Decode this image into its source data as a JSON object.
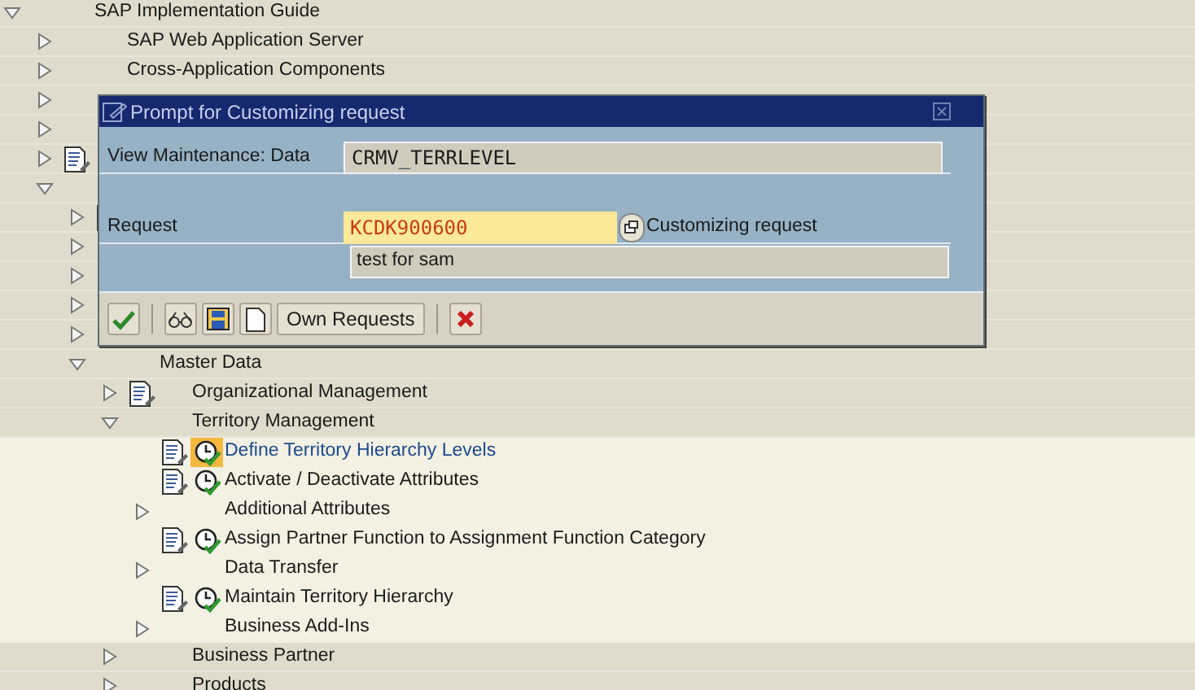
{
  "tree": [
    {
      "label": "SAP Implementation Guide",
      "kind": "folder",
      "expanded": true,
      "doc_icon": false,
      "selected": false,
      "children": [
        {
          "label": "SAP Web Application Server",
          "kind": "folder",
          "expanded": false,
          "doc_icon": false,
          "selected": false
        },
        {
          "label": "Cross-Application Components",
          "kind": "folder",
          "expanded": false,
          "doc_icon": false,
          "selected": false
        },
        {
          "kind": "folder",
          "expanded": false,
          "doc_icon": false,
          "selected": false
        },
        {
          "kind": "folder",
          "expanded": false,
          "doc_icon": false,
          "selected": false
        },
        {
          "kind": "folder",
          "expanded": false,
          "doc_icon": true,
          "selected": false
        },
        {
          "kind": "folder",
          "expanded": true,
          "doc_icon": false,
          "selected": false,
          "children": [
            {
              "kind": "folder",
              "expanded": false,
              "doc_icon": true,
              "selected": false
            },
            {
              "kind": "folder",
              "expanded": false,
              "doc_icon": false,
              "selected": false
            },
            {
              "kind": "folder",
              "expanded": false,
              "doc_icon": false,
              "selected": false
            },
            {
              "kind": "folder",
              "expanded": false,
              "doc_icon": false,
              "selected": false
            },
            {
              "kind": "folder",
              "expanded": false,
              "doc_icon": false,
              "selected": false
            },
            {
              "label": "Master Data",
              "kind": "folder",
              "expanded": true,
              "doc_icon": false,
              "selected": false,
              "children": [
                {
                  "label": "Organizational Management",
                  "kind": "folder",
                  "expanded": false,
                  "doc_icon": true,
                  "selected": false
                },
                {
                  "label": "Territory Management",
                  "kind": "folder",
                  "expanded": true,
                  "doc_icon": false,
                  "selected": false,
                  "children": [
                    {
                      "label": "Define Territory Hierarchy Levels",
                      "kind": "activity",
                      "doc_icon": true,
                      "selected": true
                    },
                    {
                      "label": "Activate / Deactivate Attributes",
                      "kind": "activity",
                      "doc_icon": true,
                      "selected": false
                    },
                    {
                      "label": "Additional Attributes",
                      "kind": "folder",
                      "expanded": false,
                      "doc_icon": false,
                      "selected": false
                    },
                    {
                      "label": "Assign Partner Function to Assignment Function Category",
                      "kind": "activity",
                      "doc_icon": true,
                      "selected": false
                    },
                    {
                      "label": "Data Transfer",
                      "kind": "folder",
                      "expanded": false,
                      "doc_icon": false,
                      "selected": false
                    },
                    {
                      "label": "Maintain Territory Hierarchy",
                      "kind": "activity",
                      "doc_icon": true,
                      "selected": false
                    },
                    {
                      "label": "Business Add-Ins",
                      "kind": "folder",
                      "expanded": false,
                      "doc_icon": false,
                      "selected": false
                    }
                  ]
                },
                {
                  "label": "Business Partner",
                  "kind": "folder",
                  "expanded": false,
                  "doc_icon": false,
                  "selected": false
                },
                {
                  "label": "Products",
                  "kind": "folder",
                  "expanded": false,
                  "doc_icon": false,
                  "selected": false
                }
              ]
            }
          ]
        }
      ]
    }
  ],
  "dialog": {
    "title": "Prompt for Customizing request",
    "object_label": "View Maintenance: Data",
    "object_value": "CRMV_TERRLEVEL",
    "request_label": "Request",
    "request_value": "KCDK900600",
    "request_hint": "Customizing request",
    "description_value": "test for sam",
    "own_requests_button": "Own Requests"
  }
}
